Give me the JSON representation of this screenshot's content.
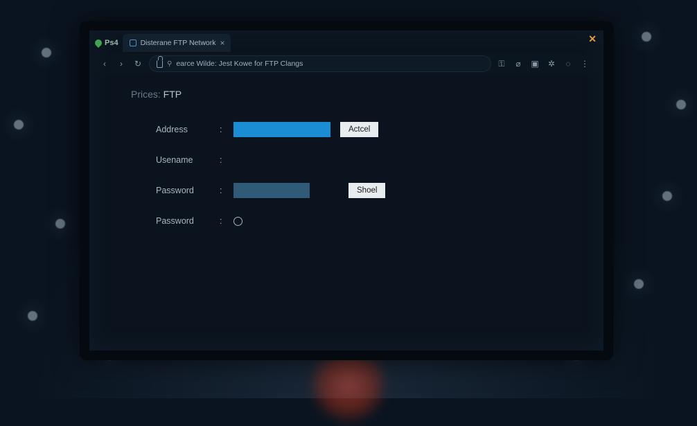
{
  "brand": {
    "label": "Ps4"
  },
  "tab": {
    "title": "Disterane FTP Network",
    "close": "×"
  },
  "nav": {
    "back": "‹",
    "forward": "›",
    "reload": "↻"
  },
  "addressBar": {
    "lock_name": "lock-icon",
    "prefix": "⚲",
    "url": "earce Wilde: Jest Kowe for FTP Clangs"
  },
  "toolbarIcons": {
    "i1": "⚿",
    "i2": "⌀",
    "i3": "▣",
    "i4": "✲",
    "i5": "◌",
    "i6": "⋮"
  },
  "windowClose": "✕",
  "page": {
    "titlePrefix": "Prices:",
    "titleMain": " FTP"
  },
  "form": {
    "address": {
      "label": "Address",
      "colon": ":",
      "value": "",
      "button": "Actcel"
    },
    "username": {
      "label": "Usename",
      "colon": ":",
      "value": ""
    },
    "password": {
      "label": "Password",
      "colon": ":",
      "value": "",
      "button": "Shoel"
    },
    "password2": {
      "label": "Password",
      "colon": ":"
    }
  }
}
